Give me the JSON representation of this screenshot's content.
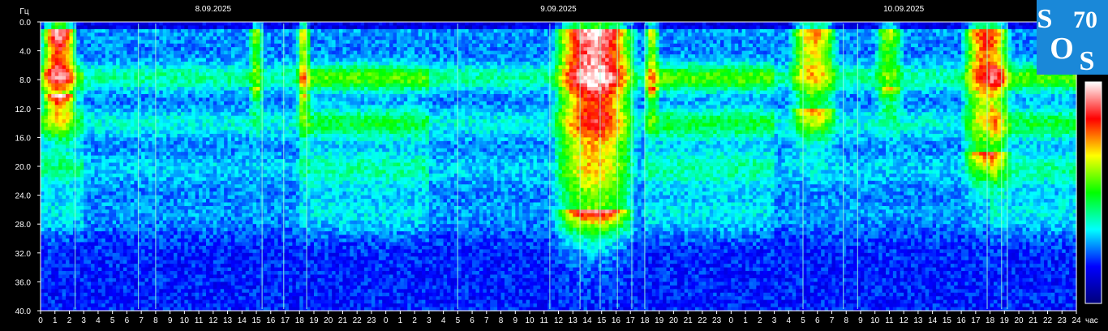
{
  "chart_data": {
    "type": "heatmap",
    "title": "",
    "y_unit_label": "Гц",
    "x_unit_label": "час",
    "dates": [
      {
        "label": "8.09.2025",
        "hour": 12
      },
      {
        "label": "9.09.2025",
        "hour": 36
      },
      {
        "label": "10.09.2025",
        "hour": 60
      }
    ],
    "x_range_hours": [
      0,
      72
    ],
    "x_tick_labels": [
      "0",
      "1",
      "2",
      "3",
      "4",
      "5",
      "6",
      "7",
      "8",
      "9",
      "10",
      "11",
      "12",
      "13",
      "14",
      "15",
      "16",
      "17",
      "18",
      "19",
      "20",
      "21",
      "22",
      "23",
      "0",
      "1",
      "2",
      "3",
      "4",
      "5",
      "6",
      "7",
      "8",
      "9",
      "10",
      "11",
      "12",
      "13",
      "14",
      "15",
      "16",
      "17",
      "18",
      "19",
      "20",
      "21",
      "22",
      "23",
      "0",
      "1",
      "2",
      "3",
      "4",
      "5",
      "6",
      "7",
      "8",
      "9",
      "10",
      "11",
      "12",
      "13",
      "14",
      "15",
      "16",
      "17",
      "18",
      "19",
      "20",
      "21",
      "22",
      "23",
      "24"
    ],
    "y_range_hz": [
      0,
      40
    ],
    "y_tick_labels": [
      "0.0",
      "4.0",
      "8.0",
      "12.0",
      "16.0",
      "20.0",
      "24.0",
      "28.0",
      "32.0",
      "36.0",
      "40.0"
    ],
    "resonance_bands_hz": [
      7.8,
      14.1,
      20.3,
      26.5
    ],
    "bursts": [
      {
        "start_hour": 0.0,
        "end_hour": 2.6,
        "max_hz": 10,
        "intensity": 1.0
      },
      {
        "start_hour": 14.5,
        "end_hour": 15.5,
        "max_hz": 9,
        "intensity": 0.5
      },
      {
        "start_hour": 17.8,
        "end_hour": 18.8,
        "max_hz": 10,
        "intensity": 0.6
      },
      {
        "start_hour": 35.5,
        "end_hour": 41.5,
        "max_hz": 26,
        "intensity": 1.0
      },
      {
        "start_hour": 42.0,
        "end_hour": 43.0,
        "max_hz": 9,
        "intensity": 0.6
      },
      {
        "start_hour": 52.0,
        "end_hour": 55.5,
        "max_hz": 12,
        "intensity": 0.7
      },
      {
        "start_hour": 58.0,
        "end_hour": 60.0,
        "max_hz": 9,
        "intensity": 0.5
      },
      {
        "start_hour": 64.0,
        "end_hour": 67.5,
        "max_hz": 18,
        "intensity": 0.8
      }
    ],
    "vertical_spikes_hours": [
      2.4,
      6.8,
      8.0,
      15.4,
      16.9,
      18.5,
      29.0,
      35.4,
      37.5,
      38.9,
      40.1,
      41.1,
      42.0,
      53.0,
      55.8,
      56.8,
      65.8,
      66.8,
      67.2
    ],
    "colorbar": {
      "stops": [
        "#00007a",
        "#0000ff",
        "#00ffff",
        "#00ff00",
        "#ffff00",
        "#ff0000",
        "#ffffff"
      ]
    },
    "grid": false,
    "legend": "colorbar right"
  },
  "logo": {
    "letters": [
      "S",
      "70",
      "O",
      "S"
    ],
    "background": "#1a88d8"
  }
}
